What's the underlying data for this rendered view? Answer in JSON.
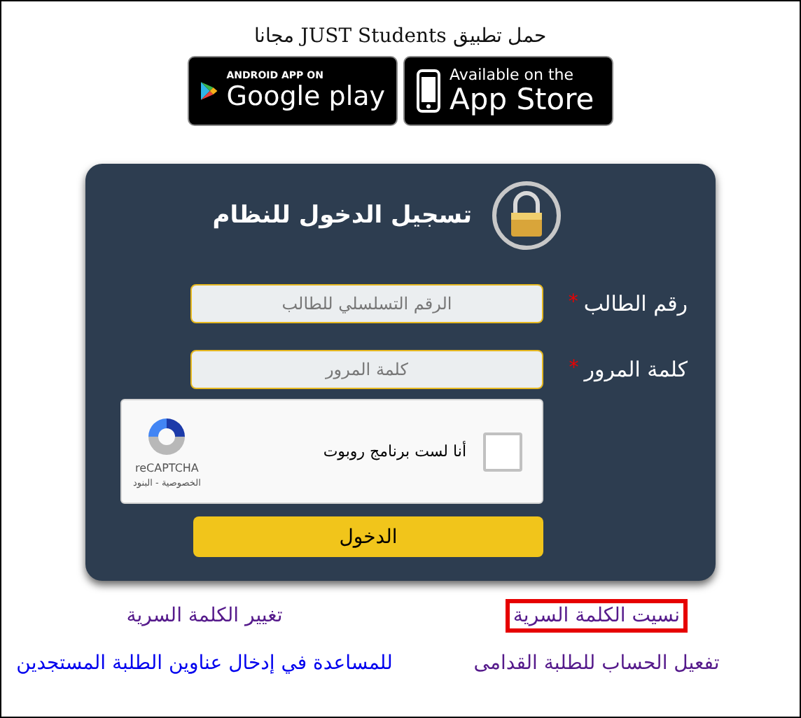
{
  "header": {
    "text": "حمل تطبيق JUST Students مجانا"
  },
  "store_badges": [
    {
      "kind": "apple",
      "small_text": "Available on the",
      "big_text": "App Store"
    },
    {
      "kind": "google",
      "small_text": "ANDROID APP ON",
      "big_text": "Google play"
    }
  ],
  "login": {
    "title": "تسجيل الدخول للنظام",
    "fields": [
      {
        "label": "رقم الطالب",
        "required_mark": "*",
        "placeholder": "الرقم التسلسلي للطالب"
      },
      {
        "label": "كلمة المرور",
        "required_mark": "*",
        "placeholder": "كلمة المرور"
      }
    ],
    "captcha": {
      "label": "أنا لست برنامج روبوت",
      "checked": false,
      "brand": "reCAPTCHA",
      "terms": "الخصوصية - البنود"
    },
    "submit": "الدخول"
  },
  "links": [
    {
      "text": "نسيت الكلمة السرية",
      "visited": true,
      "highlighted": true
    },
    {
      "text": "تغيير الكلمة السرية",
      "visited": true,
      "highlighted": false
    },
    {
      "text": "تفعيل الحساب للطلبة القدامى",
      "visited": true,
      "highlighted": false
    },
    {
      "text": "للمساعدة في إدخال عناوين الطلبة المستجدين",
      "visited": false,
      "highlighted": false
    }
  ]
}
